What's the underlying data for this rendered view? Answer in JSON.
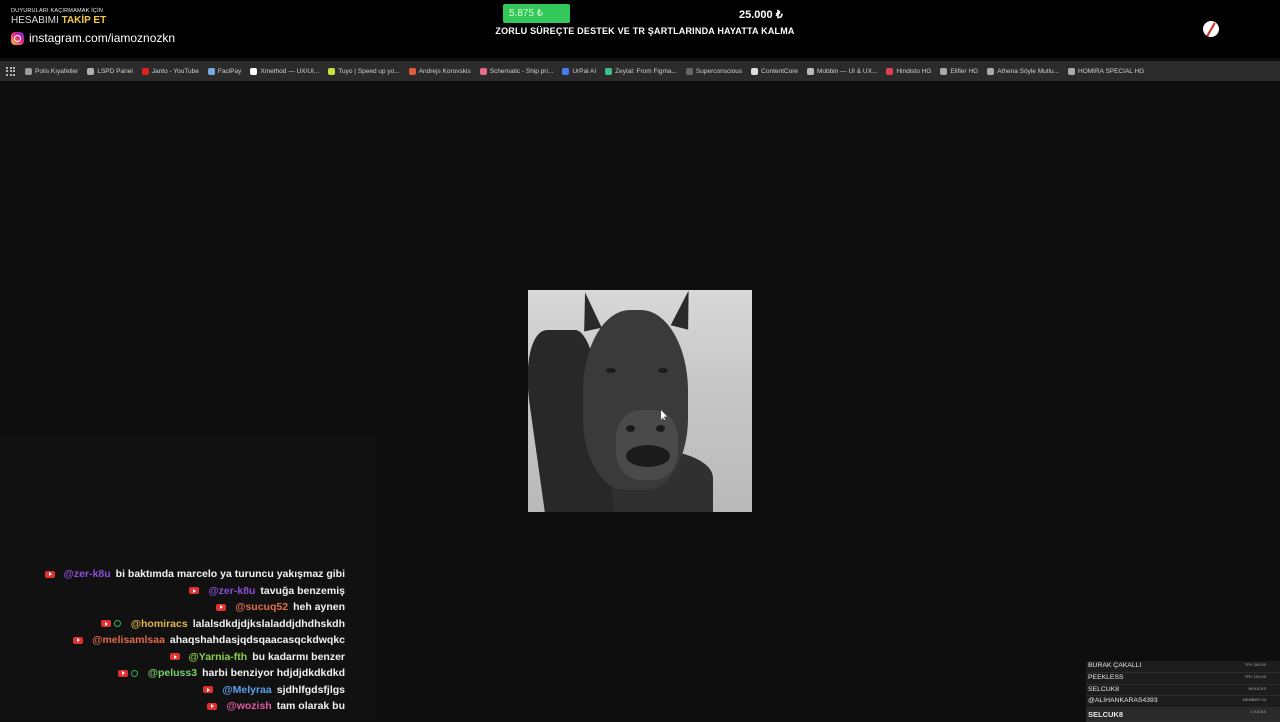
{
  "overlay": {
    "promo_line1": "DUYURULARI KAÇIRMAMAK İÇİN",
    "promo_line2_prefix": "HESABIMI",
    "promo_line2_highlight": "TAKİP ET",
    "instagram_handle": "instagram.com/iamoznozkn",
    "goal_current": "5.875 ₺",
    "goal_target": "25.000 ₺",
    "goal_progress": 0.235,
    "goal_description": "ZORLU SÜREÇTE DESTEK VE TR ŞARTLARINDA HAYATTA KALMA"
  },
  "bookmarks": [
    {
      "label": "Polis Kıyafetler",
      "icon": "folder-icon",
      "color": "#9a9a9a"
    },
    {
      "label": "LSPD Panel",
      "icon": "badge-icon",
      "color": "#b0b0b0"
    },
    {
      "label": "Janto - YouTube",
      "icon": "youtube-icon",
      "color": "#e02020"
    },
    {
      "label": "FaciPay",
      "icon": "globe-icon",
      "color": "#7aa8e0"
    },
    {
      "label": "Xmethod — UX/UI...",
      "icon": "x-icon",
      "color": "#ffffff"
    },
    {
      "label": "Tuyo | Speed up yo...",
      "icon": "tuyo-icon",
      "color": "#c6e13a"
    },
    {
      "label": "Andrejs Korovskis",
      "icon": "figma-icon",
      "color": "#e65a3c"
    },
    {
      "label": "Schematic - Ship pri...",
      "icon": "schematic-icon",
      "color": "#e26a8a"
    },
    {
      "label": "UrPal AI",
      "icon": "urpal-icon",
      "color": "#4a7cf0"
    },
    {
      "label": "Zeytal: From Figma...",
      "icon": "zeytal-icon",
      "color": "#3ac08a"
    },
    {
      "label": "Superconscious",
      "icon": "superconscious-icon",
      "color": "#666666"
    },
    {
      "label": "ContentCore",
      "icon": "cloud-icon",
      "color": "#dddddd"
    },
    {
      "label": "Mobbin — UI & UX...",
      "icon": "mobbin-icon",
      "color": "#bbbbbb"
    },
    {
      "label": "Hindisto HG",
      "icon": "hindisto-icon",
      "color": "#e0405a"
    },
    {
      "label": "Elifler HG",
      "icon": "globe-icon",
      "color": "#aaaaaa"
    },
    {
      "label": "Athena Söyle Mutlu...",
      "icon": "globe-icon",
      "color": "#aaaaaa"
    },
    {
      "label": "HOMIRA SPECIAL HG",
      "icon": "globe-icon",
      "color": "#aaaaaa"
    }
  ],
  "chat": [
    {
      "user": "@zer-k8u",
      "text": "bi baktımda marcelo ya turuncu yakışmaz gibi",
      "color": "#8a4fd8",
      "sub": false
    },
    {
      "user": "@zer-k8u",
      "text": "tavuğa benzemiş",
      "color": "#8a4fd8",
      "sub": false
    },
    {
      "user": "@sucuq52",
      "text": "heh aynen",
      "color": "#e0704a",
      "sub": false
    },
    {
      "user": "@homiracs",
      "text": "lalalsdkdjdjkslaladdjdhdhskdh",
      "color": "#e2b64a",
      "sub": true
    },
    {
      "user": "@melisamlsaa",
      "text": "ahaqshahdasjqdsqaacasqckdwqkc",
      "color": "#e06a4a",
      "sub": false
    },
    {
      "user": "@Yarnia-fth",
      "text": "bu kadarmı benzer",
      "color": "#8cd04a",
      "sub": false
    },
    {
      "user": "@peluss3",
      "text": "harbi benziyor hdjdjdkdkdkd",
      "color": "#7ad06a",
      "sub": true
    },
    {
      "user": "@Melyraa",
      "text": "sjdhlfgdsfjlgs",
      "color": "#5aa0f0",
      "sub": false
    },
    {
      "user": "@wozish",
      "text": "tam olarak bu",
      "color": "#e05aa0",
      "sub": false
    }
  ],
  "leaderboard": [
    {
      "name": "BURAK ÇAKALLI",
      "value": "TRY 250.00"
    },
    {
      "name": "PEEKLESS",
      "value": "TRY 100.00"
    },
    {
      "name": "SELCUK8",
      "value": "56 KICKS"
    },
    {
      "name": "@ALIHANKARAS4393",
      "value": "MEMBER X4"
    },
    {
      "name": "SELCUK8",
      "value": "1 KICKS"
    }
  ]
}
